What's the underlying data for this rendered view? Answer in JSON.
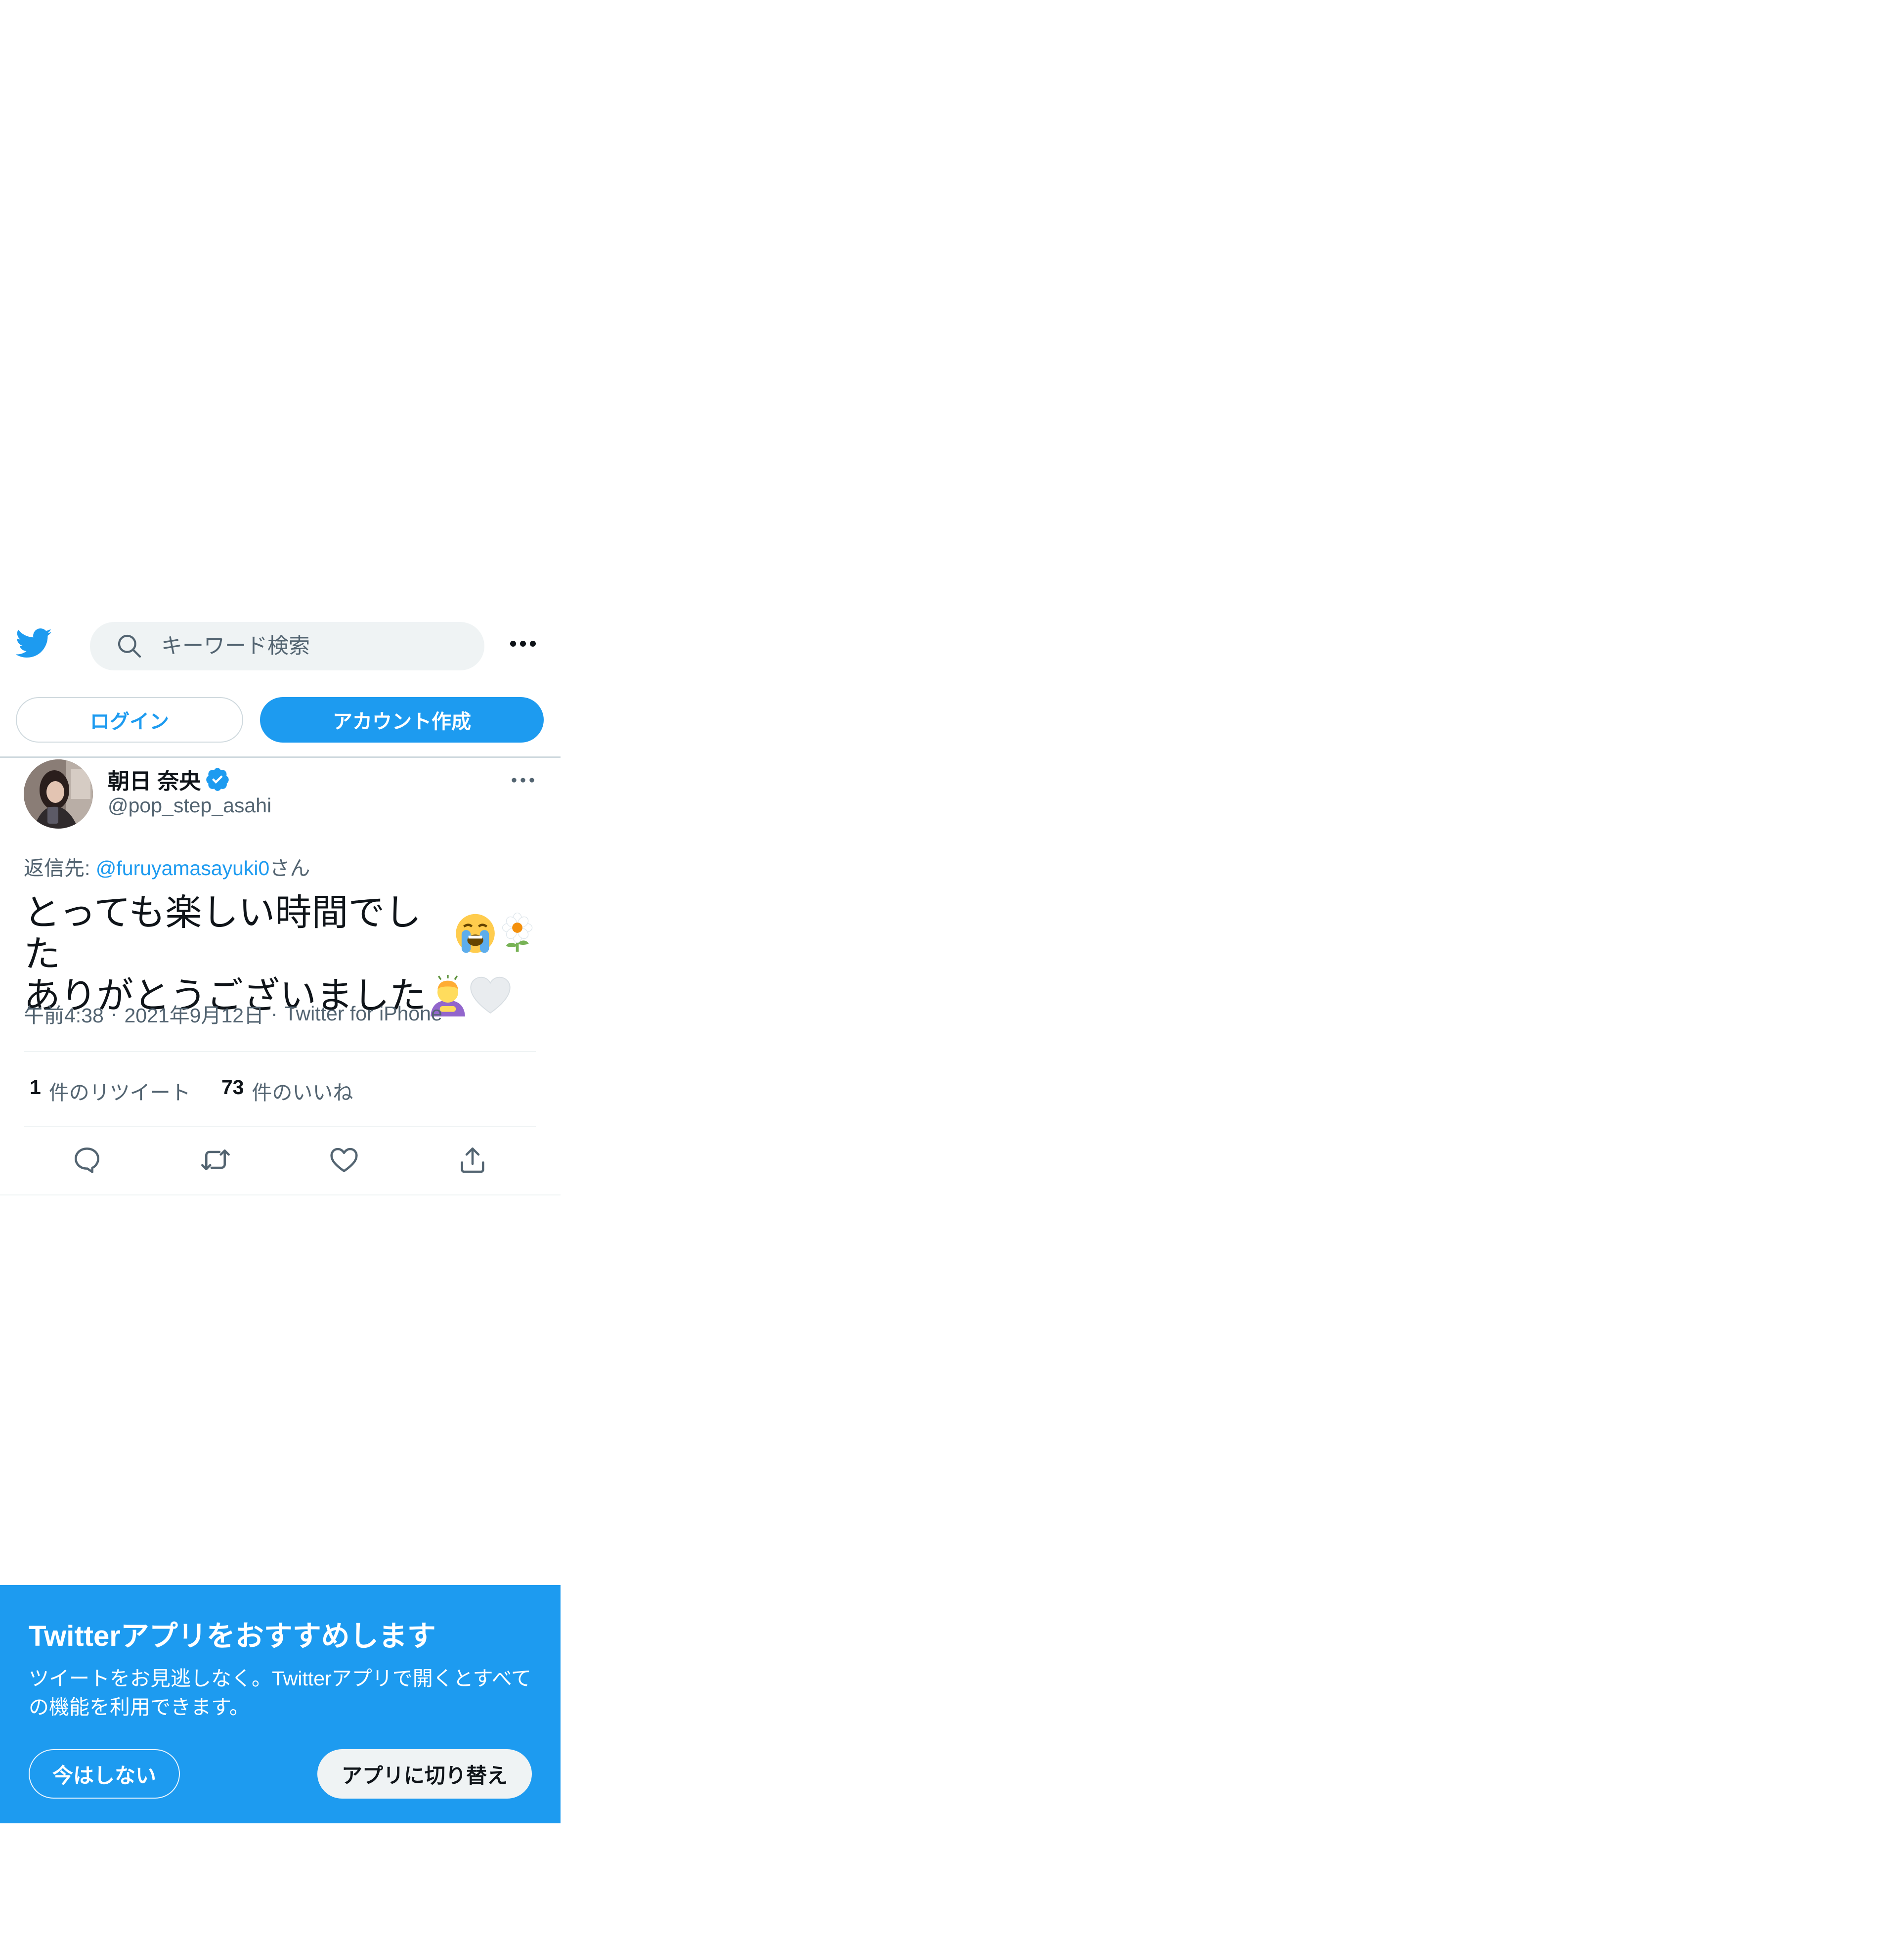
{
  "header": {
    "logo_icon": "twitter-bird-icon",
    "search_placeholder": "キーワード検索",
    "search_icon": "search-icon",
    "more_icon": "more-horizontal-icon"
  },
  "auth": {
    "login_label": "ログイン",
    "signup_label": "アカウント作成"
  },
  "tweet": {
    "display_name": "朝日 奈央",
    "verified_icon": "verified-badge-icon",
    "handle": "@pop_step_asahi",
    "reply_prefix": "返信先: ",
    "reply_mention": "@furuyamasayuki0",
    "reply_suffix": "さん",
    "text_line1": "とっても楽しい時間でした",
    "text_line2": "ありがとうございました",
    "emojis_line1": [
      "loudly-crying-face-emoji",
      "blossom-flower-emoji"
    ],
    "emojis_line2": [
      "person-bowing-emoji",
      "white-heart-emoji"
    ],
    "time": "午前4:38",
    "date": "2021年9月12日",
    "source": "Twitter for iPhone",
    "separator": "·",
    "retweet_count": "1",
    "retweet_label": "件のリツイート",
    "like_count": "73",
    "like_label": "件のいいね"
  },
  "actions": [
    "reply-icon",
    "retweet-icon",
    "like-icon",
    "share-icon"
  ],
  "banner": {
    "title": "Twitterアプリをおすすめします",
    "description": "ツイートをお見逃しなく。Twitterアプリで開くとすべての機能を利用できます。",
    "not_now_label": "今はしない",
    "switch_label": "アプリに切り替え"
  },
  "colors": {
    "brand": "#1d9bf0",
    "text_primary": "#0f1419",
    "text_secondary": "#536471"
  }
}
